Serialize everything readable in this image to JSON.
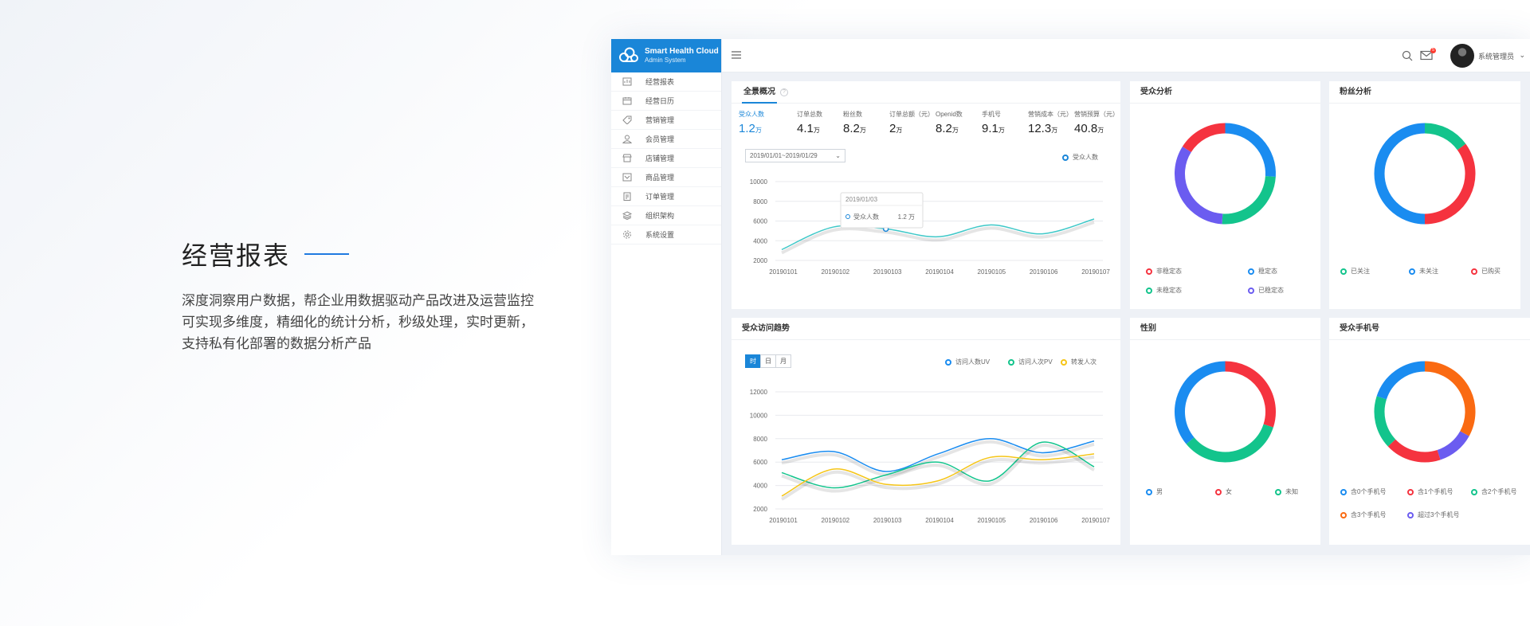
{
  "intro": {
    "title": "经营报表",
    "desc_lines": [
      "深度洞察用户数据，帮企业用数据驱动产品改进及运营监控",
      "可实现多维度，精细化的统计分析，秒级处理，实时更新，",
      "支持私有化部署的数据分析产品"
    ]
  },
  "brand": {
    "name": "Smart Health Cloud",
    "sub": "Admin System"
  },
  "sidebar": {
    "items": [
      {
        "label": "经营报表",
        "icon": "report-icon"
      },
      {
        "label": "经营日历",
        "icon": "calendar-icon"
      },
      {
        "label": "营销管理",
        "icon": "tag-icon"
      },
      {
        "label": "会员管理",
        "icon": "member-icon"
      },
      {
        "label": "店铺管理",
        "icon": "store-icon"
      },
      {
        "label": "商品管理",
        "icon": "goods-icon"
      },
      {
        "label": "订单管理",
        "icon": "order-icon"
      },
      {
        "label": "组织架构",
        "icon": "layers-icon"
      },
      {
        "label": "系统设置",
        "icon": "gear-icon"
      }
    ]
  },
  "topbar": {
    "user_name": "系统管理员",
    "mail_badge": "5"
  },
  "overview": {
    "title": "全景概况",
    "kpis": [
      {
        "label": "受众人数",
        "value": "1.2",
        "unit": "万"
      },
      {
        "label": "订单总数",
        "value": "4.1",
        "unit": "万"
      },
      {
        "label": "粉丝数",
        "value": "8.2",
        "unit": "万"
      },
      {
        "label": "订单总额（元）",
        "value": "2",
        "unit": "万"
      },
      {
        "label": "Openid数",
        "value": "8.2",
        "unit": "万"
      },
      {
        "label": "手机号",
        "value": "9.1",
        "unit": "万"
      },
      {
        "label": "营销成本（元）",
        "value": "12.3",
        "unit": "万"
      },
      {
        "label": "营销预算（元）",
        "value": "40.8",
        "unit": "万"
      }
    ],
    "date_range": "2019/01/01~2019/01/29",
    "legend": "受众人数",
    "tooltip": {
      "date": "2019/01/03",
      "label": "受众人数",
      "value": "1.2 万"
    }
  },
  "trend": {
    "title": "受众访问趋势",
    "segments": [
      "时",
      "日",
      "月"
    ],
    "legend": [
      "访问人数UV",
      "访问人次PV",
      "转发人次"
    ]
  },
  "donuts": {
    "audience": {
      "title": "受众分析",
      "legend": [
        "非稳定态",
        "稳定态",
        "未稳定态",
        "已稳定态"
      ]
    },
    "fans": {
      "title": "粉丝分析",
      "legend": [
        "已关注",
        "未关注",
        "已购买"
      ]
    },
    "gender": {
      "title": "性别",
      "legend": [
        "男",
        "女",
        "未知"
      ]
    },
    "phone": {
      "title": "受众手机号",
      "legend": [
        "含0个手机号",
        "含1个手机号",
        "含2个手机号",
        "含3个手机号",
        "超过3个手机号"
      ]
    }
  },
  "colors": {
    "blue": "#1a8cf0",
    "red": "#f5333f",
    "green": "#13c48c",
    "purple": "#6b5cf0",
    "orange": "#fa6a12",
    "yellow": "#f5c518",
    "teal": "#3ec8c8",
    "accent": "#1a86d8"
  },
  "chart_data": [
    {
      "type": "line",
      "x": [
        "20190101",
        "20190102",
        "20190103",
        "20190104",
        "20190105",
        "20190106",
        "20190107"
      ],
      "series": [
        {
          "name": "受众人数",
          "values": [
            3100,
            5400,
            5200,
            4400,
            5600,
            4700,
            6200
          ]
        }
      ],
      "ylim": [
        2000,
        10000
      ],
      "yticks": [
        2000,
        4000,
        6000,
        8000,
        10000
      ]
    },
    {
      "type": "line",
      "x": [
        "20190101",
        "20190102",
        "20190103",
        "20190104",
        "20190105",
        "20190106",
        "20190107"
      ],
      "series": [
        {
          "name": "访问人数UV",
          "values": [
            6200,
            6900,
            5200,
            6700,
            8000,
            6800,
            7800
          ]
        },
        {
          "name": "访问人次PV",
          "values": [
            5100,
            3800,
            4900,
            6000,
            4400,
            7700,
            5600
          ]
        },
        {
          "name": "转发人次",
          "values": [
            3100,
            5400,
            4100,
            4400,
            6400,
            6200,
            6700
          ]
        }
      ],
      "ylim": [
        2000,
        12000
      ],
      "yticks": [
        2000,
        4000,
        6000,
        8000,
        10000,
        12000
      ]
    },
    {
      "type": "pie",
      "title": "受众分析",
      "labels": [
        "非稳定态",
        "稳定态",
        "未稳定态",
        "已稳定态"
      ],
      "values": [
        16,
        26,
        25,
        33
      ]
    },
    {
      "type": "pie",
      "title": "粉丝分析",
      "labels": [
        "已关注",
        "未关注",
        "已购买"
      ],
      "values": [
        15,
        50,
        35
      ]
    },
    {
      "type": "pie",
      "title": "性别",
      "labels": [
        "男",
        "女",
        "未知"
      ],
      "values": [
        36,
        30,
        34
      ]
    },
    {
      "type": "pie",
      "title": "受众手机号",
      "labels": [
        "含0个手机号",
        "含1个手机号",
        "含2个手机号",
        "含3个手机号",
        "超过3个手机号"
      ],
      "values": [
        20,
        18,
        17,
        33,
        12
      ]
    }
  ]
}
